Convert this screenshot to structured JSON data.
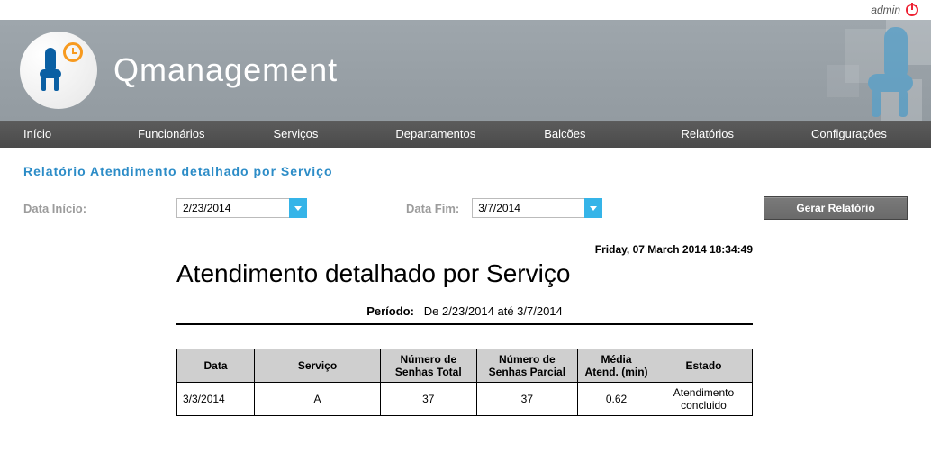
{
  "user": {
    "name": "admin"
  },
  "brand": "Qmanagement",
  "nav": {
    "inicio": "Início",
    "funcionarios": "Funcionários",
    "servicos": "Serviços",
    "departamentos": "Departamentos",
    "balcoes": "Balcões",
    "relatorios": "Relatórios",
    "configuracoes": "Configurações"
  },
  "crumb": "Relatório Atendimento detalhado por Serviço",
  "filters": {
    "start_label": "Data Início:",
    "start_value": "2/23/2014",
    "end_label": "Data Fim:",
    "end_value": "3/7/2014",
    "button": "Gerar Relatório"
  },
  "report": {
    "timestamp": "Friday, 07 March 2014 18:34:49",
    "title": "Atendimento detalhado por Serviço",
    "period_label": "Período:",
    "period_value": "De 2/23/2014 até 3/7/2014",
    "columns": {
      "data": "Data",
      "servico": "Serviço",
      "senhas_total": "Número de Senhas Total",
      "senhas_parcial": "Número de Senhas Parcial",
      "media": "Média Atend. (min)",
      "estado": "Estado"
    },
    "rows": [
      {
        "data": "3/3/2014",
        "servico": "A",
        "senhas_total": "37",
        "senhas_parcial": "37",
        "media": "0.62",
        "estado": "Atendimento concluido"
      }
    ]
  }
}
